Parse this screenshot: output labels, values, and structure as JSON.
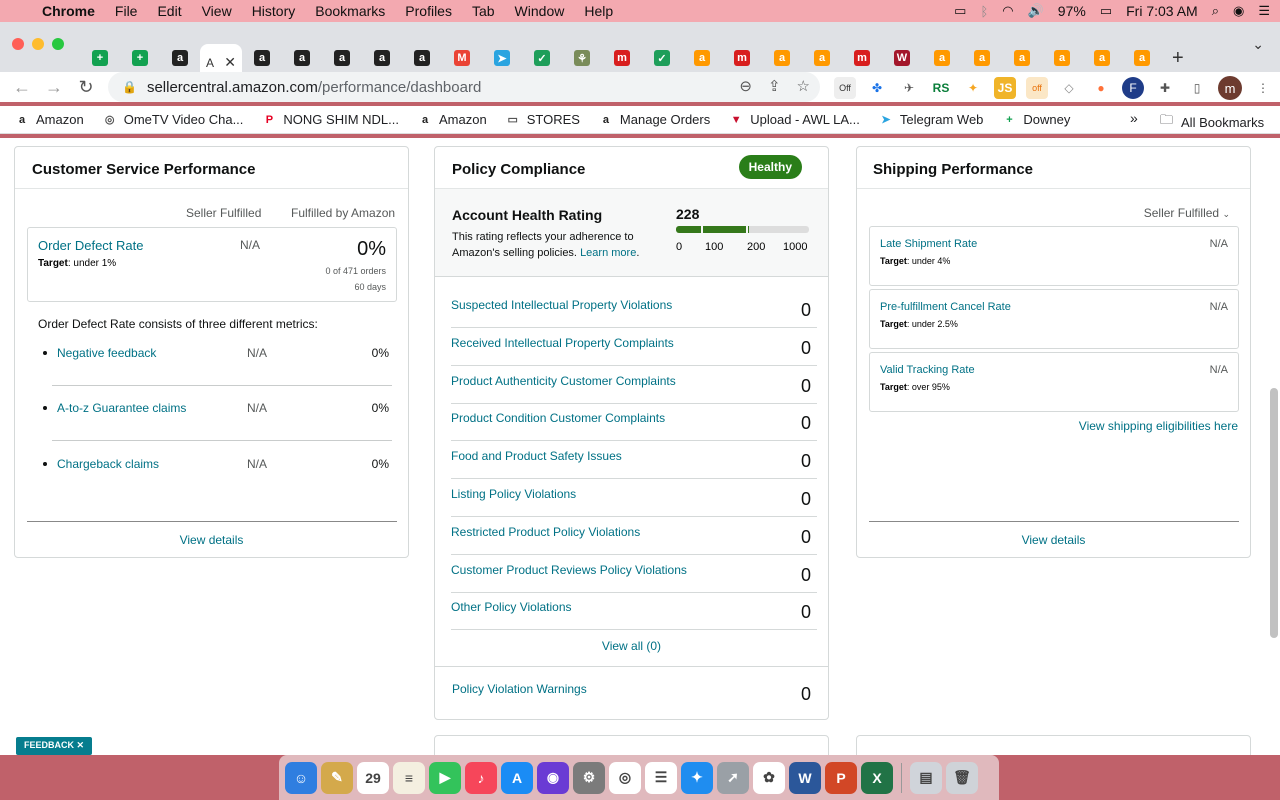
{
  "menubar": {
    "app": "Chrome",
    "items": [
      "File",
      "Edit",
      "View",
      "History",
      "Bookmarks",
      "Profiles",
      "Tab",
      "Window",
      "Help"
    ],
    "battery": "97%",
    "clock": "Fri 7:03 AM"
  },
  "tabs": {
    "active_title": "A",
    "close": "✕",
    "new_tab": "+",
    "favicons": [
      {
        "glyph": "+",
        "bg": "#12a150"
      },
      {
        "glyph": "+",
        "bg": "#12a150"
      },
      {
        "glyph": "a",
        "bg": "#222"
      },
      {
        "glyph": "ACTIVE",
        "bg": "#fff"
      },
      {
        "glyph": "a",
        "bg": "#222"
      },
      {
        "glyph": "a",
        "bg": "#222"
      },
      {
        "glyph": "a",
        "bg": "#222"
      },
      {
        "glyph": "a",
        "bg": "#222"
      },
      {
        "glyph": "a",
        "bg": "#222"
      },
      {
        "glyph": "M",
        "bg": "#ea4335"
      },
      {
        "glyph": "➤",
        "bg": "#2aa4e0"
      },
      {
        "glyph": "✓",
        "bg": "#1e9e5a"
      },
      {
        "glyph": "⚘",
        "bg": "#7a8c5a"
      },
      {
        "glyph": "m",
        "bg": "#d81e1e"
      },
      {
        "glyph": "✓",
        "bg": "#1e9e5a"
      },
      {
        "glyph": "a",
        "bg": "#ff9900"
      },
      {
        "glyph": "m",
        "bg": "#d81e1e"
      },
      {
        "glyph": "a",
        "bg": "#ff9900"
      },
      {
        "glyph": "a",
        "bg": "#ff9900"
      },
      {
        "glyph": "m",
        "bg": "#d81e1e"
      },
      {
        "glyph": "W",
        "bg": "#a3172b"
      },
      {
        "glyph": "a",
        "bg": "#ff9900"
      },
      {
        "glyph": "a",
        "bg": "#ff9900"
      },
      {
        "glyph": "a",
        "bg": "#ff9900"
      },
      {
        "glyph": "a",
        "bg": "#ff9900"
      },
      {
        "glyph": "a",
        "bg": "#ff9900"
      },
      {
        "glyph": "a",
        "bg": "#ff9900"
      }
    ]
  },
  "toolbar": {
    "url_host": "sellercentral.amazon.com",
    "url_path": "/performance/dashboard",
    "profile_initial": "m",
    "ext_off_badge": "off",
    "ext_labels": [
      "Off",
      "✚",
      "RS",
      "JS",
      "off"
    ]
  },
  "bookmarks": {
    "items": [
      {
        "label": "Amazon",
        "icon": "a",
        "color": "#222"
      },
      {
        "label": "OmeTV Video Cha...",
        "icon": "◎",
        "color": "#555"
      },
      {
        "label": "NONG SHIM NDL...",
        "icon": "P",
        "color": "#e60023"
      },
      {
        "label": "Amazon",
        "icon": "a",
        "color": "#222"
      },
      {
        "label": "STORES",
        "icon": "▭",
        "color": "#555"
      },
      {
        "label": "Manage Orders",
        "icon": "a",
        "color": "#222"
      },
      {
        "label": "Upload - AWL LA...",
        "icon": "▼",
        "color": "#c8102e"
      },
      {
        "label": "Telegram Web",
        "icon": "➤",
        "color": "#2aa4e0"
      },
      {
        "label": "Downey",
        "icon": "+",
        "color": "#12a150"
      }
    ],
    "more": "»",
    "all": "All Bookmarks"
  },
  "customer_service": {
    "title": "Customer Service Performance",
    "col_seller": "Seller Fulfilled",
    "col_amazon": "Fulfilled by Amazon",
    "odr_label": "Order Defect Rate",
    "odr_target_prefix": "Target",
    "odr_target": ": under 1%",
    "odr_seller": "N/A",
    "odr_amazon": "0%",
    "odr_orders": "0 of 471 orders",
    "odr_days": "60 days",
    "consists": "Order Defect Rate consists of three different metrics:",
    "metrics": [
      {
        "label": "Negative feedback",
        "seller": "N/A",
        "amazon": "0%"
      },
      {
        "label": "A-to-z Guarantee claims",
        "seller": "N/A",
        "amazon": "0%"
      },
      {
        "label": "Chargeback claims",
        "seller": "N/A",
        "amazon": "0%"
      }
    ],
    "view_details": "View details"
  },
  "policy": {
    "title": "Policy Compliance",
    "badge": "Healthy",
    "ahr_title": "Account Health Rating",
    "ahr_desc": "This rating reflects your adherence to Amazon's selling policies.",
    "learn_more": "Learn more",
    "ahr_value": "228",
    "ahr_score": 228,
    "scale": [
      "0",
      "100",
      "200",
      "1000"
    ],
    "rows": [
      {
        "label": "Suspected Intellectual Property Violations",
        "value": "0"
      },
      {
        "label": "Received Intellectual Property Complaints",
        "value": "0"
      },
      {
        "label": "Product Authenticity Customer Complaints",
        "value": "0"
      },
      {
        "label": "Product Condition Customer Complaints",
        "value": "0"
      },
      {
        "label": "Food and Product Safety Issues",
        "value": "0"
      },
      {
        "label": "Listing Policy Violations",
        "value": "0"
      },
      {
        "label": "Restricted Product Policy Violations",
        "value": "0"
      },
      {
        "label": "Customer Product Reviews Policy Violations",
        "value": "0"
      },
      {
        "label": "Other Policy Violations",
        "value": "0"
      }
    ],
    "view_all": "View all (0)",
    "warnings_label": "Policy Violation Warnings",
    "warnings_value": "0"
  },
  "shipping": {
    "title": "Shipping Performance",
    "filter": "Seller Fulfilled",
    "metrics": [
      {
        "label": "Late Shipment Rate",
        "target": ": under 4%",
        "value": "N/A"
      },
      {
        "label": "Pre-fulfillment Cancel Rate",
        "target": ": under 2.5%",
        "value": "N/A"
      },
      {
        "label": "Valid Tracking Rate",
        "target": ": over 95%",
        "value": "N/A"
      }
    ],
    "target_prefix": "Target",
    "eligibilities": "View shipping eligibilities here",
    "view_details": "View details"
  },
  "feedback": "FEEDBACK ✕",
  "dock": {
    "apps": [
      {
        "name": "finder",
        "glyph": "☺",
        "bg": "#2f7ee0"
      },
      {
        "name": "notes",
        "glyph": "✎",
        "bg": "#d4a94b"
      },
      {
        "name": "calendar",
        "glyph": "29",
        "bg": "#ffffff"
      },
      {
        "name": "stickies",
        "glyph": "≡",
        "bg": "#f4efe0"
      },
      {
        "name": "facetime",
        "glyph": "▶",
        "bg": "#33c35b"
      },
      {
        "name": "music",
        "glyph": "♪",
        "bg": "#f6465a"
      },
      {
        "name": "app-store",
        "glyph": "A",
        "bg": "#1a8cf5"
      },
      {
        "name": "siri",
        "glyph": "◉",
        "bg": "#6a3bd4"
      },
      {
        "name": "settings",
        "glyph": "⚙",
        "bg": "#7b7b7b"
      },
      {
        "name": "chrome",
        "glyph": "◎",
        "bg": "#ffffff"
      },
      {
        "name": "reminders",
        "glyph": "☰",
        "bg": "#ffffff"
      },
      {
        "name": "safari",
        "glyph": "✦",
        "bg": "#1f8df0"
      },
      {
        "name": "launchpad",
        "glyph": "➚",
        "bg": "#9aa0a6"
      },
      {
        "name": "photos",
        "glyph": "✿",
        "bg": "#ffffff"
      },
      {
        "name": "word",
        "glyph": "W",
        "bg": "#2b579a"
      },
      {
        "name": "powerpoint",
        "glyph": "P",
        "bg": "#d24726"
      },
      {
        "name": "excel",
        "glyph": "X",
        "bg": "#217346"
      },
      {
        "name": "downloads",
        "glyph": "▤",
        "bg": "#d0d4da"
      },
      {
        "name": "trash",
        "glyph": "🗑",
        "bg": "#cfd3d8"
      }
    ],
    "calendar_month": "SEP"
  }
}
